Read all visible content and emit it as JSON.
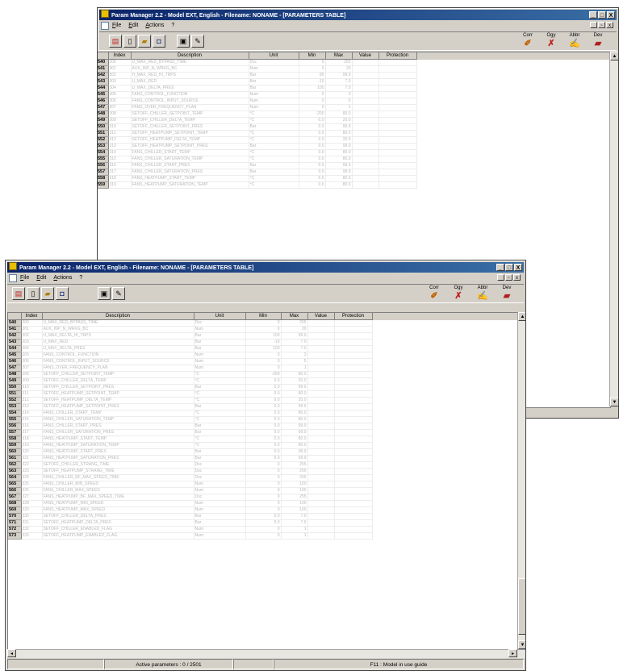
{
  "app_title": "Param Manager 2.2 - Model EXT, English - Filename: NONAME - [PARAMETERS TABLE]",
  "window_controls": {
    "minimize": "_",
    "restore": "□",
    "close": "X"
  },
  "mdi_controls": {
    "minimize": "_",
    "restore": "▫",
    "close": "x"
  },
  "menu": [
    "File",
    "Edit",
    "Actions",
    "?"
  ],
  "toolbar_right": [
    {
      "label": "Corr",
      "icon": "wand-icon",
      "color": "#c06000"
    },
    {
      "label": "Ogy",
      "icon": "tools-icon",
      "color": "#c02020"
    },
    {
      "label": "Abbr",
      "icon": "pencil-icon",
      "color": "#c04000"
    },
    {
      "label": "Dev",
      "icon": "folder-icon",
      "color": "#b02020"
    }
  ],
  "columns": [
    "Index",
    "Description",
    "Unit",
    "Min",
    "Max",
    "Value",
    "Protection"
  ],
  "rows_back": [
    {
      "n": "540",
      "i": "300",
      "d": "U_MAX_RED_BYPASS_TIME",
      "u": "Dsc",
      "mn": "0",
      "mx": "255"
    },
    {
      "n": "541",
      "i": "301",
      "d": "AUX_INP_N_WRKG_BC",
      "u": "Num",
      "mn": "0",
      "mx": "20"
    },
    {
      "n": "542",
      "i": "302",
      "d": "H_MAX_RED_HI_TRPS",
      "u": "Bar",
      "mn": "80",
      "mx": "99.9"
    },
    {
      "n": "543",
      "i": "303",
      "d": "U_MAX_RED",
      "u": "Bar",
      "mn": "-10",
      "mx": "7.0"
    },
    {
      "n": "544",
      "i": "304",
      "d": "U_MAX_DELTA_PRES",
      "u": "Bar",
      "mn": "100",
      "mx": "7.0"
    },
    {
      "n": "545",
      "i": "305",
      "d": "FANS_CONTROL_FUNCTION",
      "u": "Num",
      "mn": "0",
      "mx": "3"
    },
    {
      "n": "546",
      "i": "306",
      "d": "FANS_CONTROL_INPUT_SOURCE",
      "u": "Num",
      "mn": "0",
      "mx": "5"
    },
    {
      "n": "547",
      "i": "307",
      "d": "FANS_OVER_FREQUENCY_PLAN",
      "u": "Num",
      "mn": "0",
      "mx": "1"
    },
    {
      "n": "548",
      "i": "308",
      "d": "SETOFF_CHILLER_SETPOINT_TEMP",
      "u": "°C",
      "mn": "-200",
      "mx": "80.0"
    },
    {
      "n": "549",
      "i": "309",
      "d": "SETOFF_CHILLER_DELTA_TEMP",
      "u": "°C",
      "mn": "0.0",
      "mx": "20.0"
    },
    {
      "n": "550",
      "i": "310",
      "d": "SETOFF_CHILLER_SETPOINT_PRES",
      "u": "Bar",
      "mn": "0.0",
      "mx": "99.9"
    },
    {
      "n": "551",
      "i": "311",
      "d": "SETOFF_HEATPUMP_SETPOINT_TEMP",
      "u": "°C",
      "mn": "0.0",
      "mx": "80.0"
    },
    {
      "n": "552",
      "i": "312",
      "d": "SETOFF_HEATPUMP_DELTA_TEMP",
      "u": "°C",
      "mn": "0.0",
      "mx": "20.0"
    },
    {
      "n": "553",
      "i": "313",
      "d": "SETOFF_HEATPUMP_SETPOINT_PRES",
      "u": "Bar",
      "mn": "0.0",
      "mx": "99.9"
    },
    {
      "n": "554",
      "i": "314",
      "d": "FANS_CHILLER_START_TEMP",
      "u": "°C",
      "mn": "0.0",
      "mx": "80.0"
    },
    {
      "n": "555",
      "i": "315",
      "d": "FANS_CHILLER_SATURATION_TEMP",
      "u": "°C",
      "mn": "0.0",
      "mx": "80.0"
    },
    {
      "n": "556",
      "i": "316",
      "d": "FANS_CHILLER_START_PRES",
      "u": "Bar",
      "mn": "0.0",
      "mx": "99.9"
    },
    {
      "n": "557",
      "i": "317",
      "d": "FANS_CHILLER_SATURATION_PRES",
      "u": "Bar",
      "mn": "0.0",
      "mx": "99.9"
    },
    {
      "n": "558",
      "i": "318",
      "d": "FANS_HEATPUMP_START_TEMP",
      "u": "°C",
      "mn": "0.0",
      "mx": "80.0"
    },
    {
      "n": "559",
      "i": "319",
      "d": "FANS_HEATPUMP_SATURATION_TEMP",
      "u": "°C",
      "mn": "0.0",
      "mx": "80.0"
    }
  ],
  "rows_front": [
    {
      "n": "540",
      "i": "300",
      "d": "U_MAX_RED_BYPASS_TIME",
      "u": "Dsc",
      "mn": "0",
      "mx": "255"
    },
    {
      "n": "541",
      "i": "301",
      "d": "AUX_INP_N_WRKG_BC",
      "u": "Num",
      "mn": "0",
      "mx": "20"
    },
    {
      "n": "542",
      "i": "302",
      "d": "U_MAX_DELTA_HI_TRPS",
      "u": "Bar",
      "mn": "100",
      "mx": "99.9"
    },
    {
      "n": "543",
      "i": "303",
      "d": "U_MAX_RED",
      "u": "Bar",
      "mn": "-10",
      "mx": "7.0"
    },
    {
      "n": "544",
      "i": "304",
      "d": "U_MAX_DELTA_PRES",
      "u": "Bar",
      "mn": "100",
      "mx": "7.0"
    },
    {
      "n": "545",
      "i": "305",
      "d": "FANS_CONTROL_FUNCTION",
      "u": "Num",
      "mn": "0",
      "mx": "3"
    },
    {
      "n": "546",
      "i": "306",
      "d": "FANS_CONTROL_INPUT_SOURCE",
      "u": "Num",
      "mn": "0",
      "mx": "5"
    },
    {
      "n": "547",
      "i": "307",
      "d": "FANS_OVER_FREQUENCY_PLAN",
      "u": "Num",
      "mn": "0",
      "mx": "1"
    },
    {
      "n": "548",
      "i": "308",
      "d": "SETOFF_CHILLER_SETPOINT_TEMP",
      "u": "°C",
      "mn": "-200",
      "mx": "80.0"
    },
    {
      "n": "549",
      "i": "309",
      "d": "SETOFF_CHILLER_DELTA_TEMP",
      "u": "°C",
      "mn": "0.0",
      "mx": "20.0"
    },
    {
      "n": "550",
      "i": "310",
      "d": "SETOFF_CHILLER_SETPOINT_PRES",
      "u": "Bar",
      "mn": "0.0",
      "mx": "99.9"
    },
    {
      "n": "551",
      "i": "311",
      "d": "SETOFF_HEATPUMP_SETPOINT_TEMP",
      "u": "°C",
      "mn": "0.0",
      "mx": "80.0"
    },
    {
      "n": "552",
      "i": "312",
      "d": "SETOFF_HEATPUMP_DELTA_TEMP",
      "u": "°C",
      "mn": "0.0",
      "mx": "20.0"
    },
    {
      "n": "553",
      "i": "313",
      "d": "SETOFF_HEATPUMP_SETPOINT_PRES",
      "u": "Bar",
      "mn": "0.0",
      "mx": "99.9"
    },
    {
      "n": "554",
      "i": "314",
      "d": "FANS_CHILLER_START_TEMP",
      "u": "°C",
      "mn": "0.0",
      "mx": "80.0"
    },
    {
      "n": "555",
      "i": "315",
      "d": "FANS_CHILLER_SATURATION_TEMP",
      "u": "°C",
      "mn": "0.0",
      "mx": "80.0"
    },
    {
      "n": "556",
      "i": "316",
      "d": "FANS_CHILLER_START_PRES",
      "u": "Bar",
      "mn": "0.0",
      "mx": "99.9"
    },
    {
      "n": "557",
      "i": "317",
      "d": "FANS_CHILLER_SATURATION_PRES",
      "u": "Bar",
      "mn": "0.0",
      "mx": "99.9"
    },
    {
      "n": "558",
      "i": "318",
      "d": "FANS_HEATPUMP_START_TEMP",
      "u": "°C",
      "mn": "0.0",
      "mx": "80.0"
    },
    {
      "n": "559",
      "i": "319",
      "d": "FANS_HEATPUMP_SATURATION_TEMP",
      "u": "°C",
      "mn": "0.0",
      "mx": "80.0"
    },
    {
      "n": "560",
      "i": "320",
      "d": "FANS_HEATPUMP_START_PRES",
      "u": "Bar",
      "mn": "0.0",
      "mx": "99.9"
    },
    {
      "n": "561",
      "i": "321",
      "d": "FANS_HEATPUMP_SATURATION_PRES",
      "u": "Bar",
      "mn": "0.0",
      "mx": "99.9"
    },
    {
      "n": "562",
      "i": "322",
      "d": "SETOFF_CHILLER_STRANG_TIME",
      "u": "Dsc",
      "mn": "0",
      "mx": "255"
    },
    {
      "n": "563",
      "i": "323",
      "d": "SETOFF_HEATPUMP_STRANG_TIME",
      "u": "Dsc",
      "mn": "0",
      "mx": "255"
    },
    {
      "n": "564",
      "i": "324",
      "d": "FANS_CHILLER_BF_MAX_SPEED_TIME",
      "u": "Dsc",
      "mn": "0",
      "mx": "255"
    },
    {
      "n": "565",
      "i": "325",
      "d": "FANS_CHILLER_MIN_SPEED",
      "u": "Num",
      "mn": "0",
      "mx": "100"
    },
    {
      "n": "566",
      "i": "326",
      "d": "FANS_CHILLER_MAX_SPEED",
      "u": "Num",
      "mn": "0",
      "mx": "100"
    },
    {
      "n": "567",
      "i": "327",
      "d": "FANS_HEATPUMP_BF_MAX_SPEED_TIME",
      "u": "Dsc",
      "mn": "0",
      "mx": "255"
    },
    {
      "n": "568",
      "i": "328",
      "d": "FANS_HEATPUMP_MIN_SPEED",
      "u": "Num",
      "mn": "0",
      "mx": "100"
    },
    {
      "n": "569",
      "i": "329",
      "d": "FANS_HEATPUMP_MAX_SPEED",
      "u": "Num",
      "mn": "0",
      "mx": "100"
    },
    {
      "n": "570",
      "i": "330",
      "d": "SETOFF_CHILLER_DELTA_PRES",
      "u": "Bar",
      "mn": "0.0",
      "mx": "7.0"
    },
    {
      "n": "571",
      "i": "331",
      "d": "SETOFF_HEATPUMP_DELTA_PRES",
      "u": "Bar",
      "mn": "0.0",
      "mx": "7.0"
    },
    {
      "n": "572",
      "i": "332",
      "d": "SETOFF_CHILLER_ENABLED_FLAG",
      "u": "Num",
      "mn": "0",
      "mx": "1"
    },
    {
      "n": "573",
      "i": "333",
      "d": "SETOFF_HEATPUMP_ENABLED_FLAG",
      "u": "Num",
      "mn": "0",
      "mx": "1"
    }
  ],
  "status": {
    "active_parameters": "Active parameters : 0 / 2501",
    "help": "F11 : Model in use guide"
  }
}
